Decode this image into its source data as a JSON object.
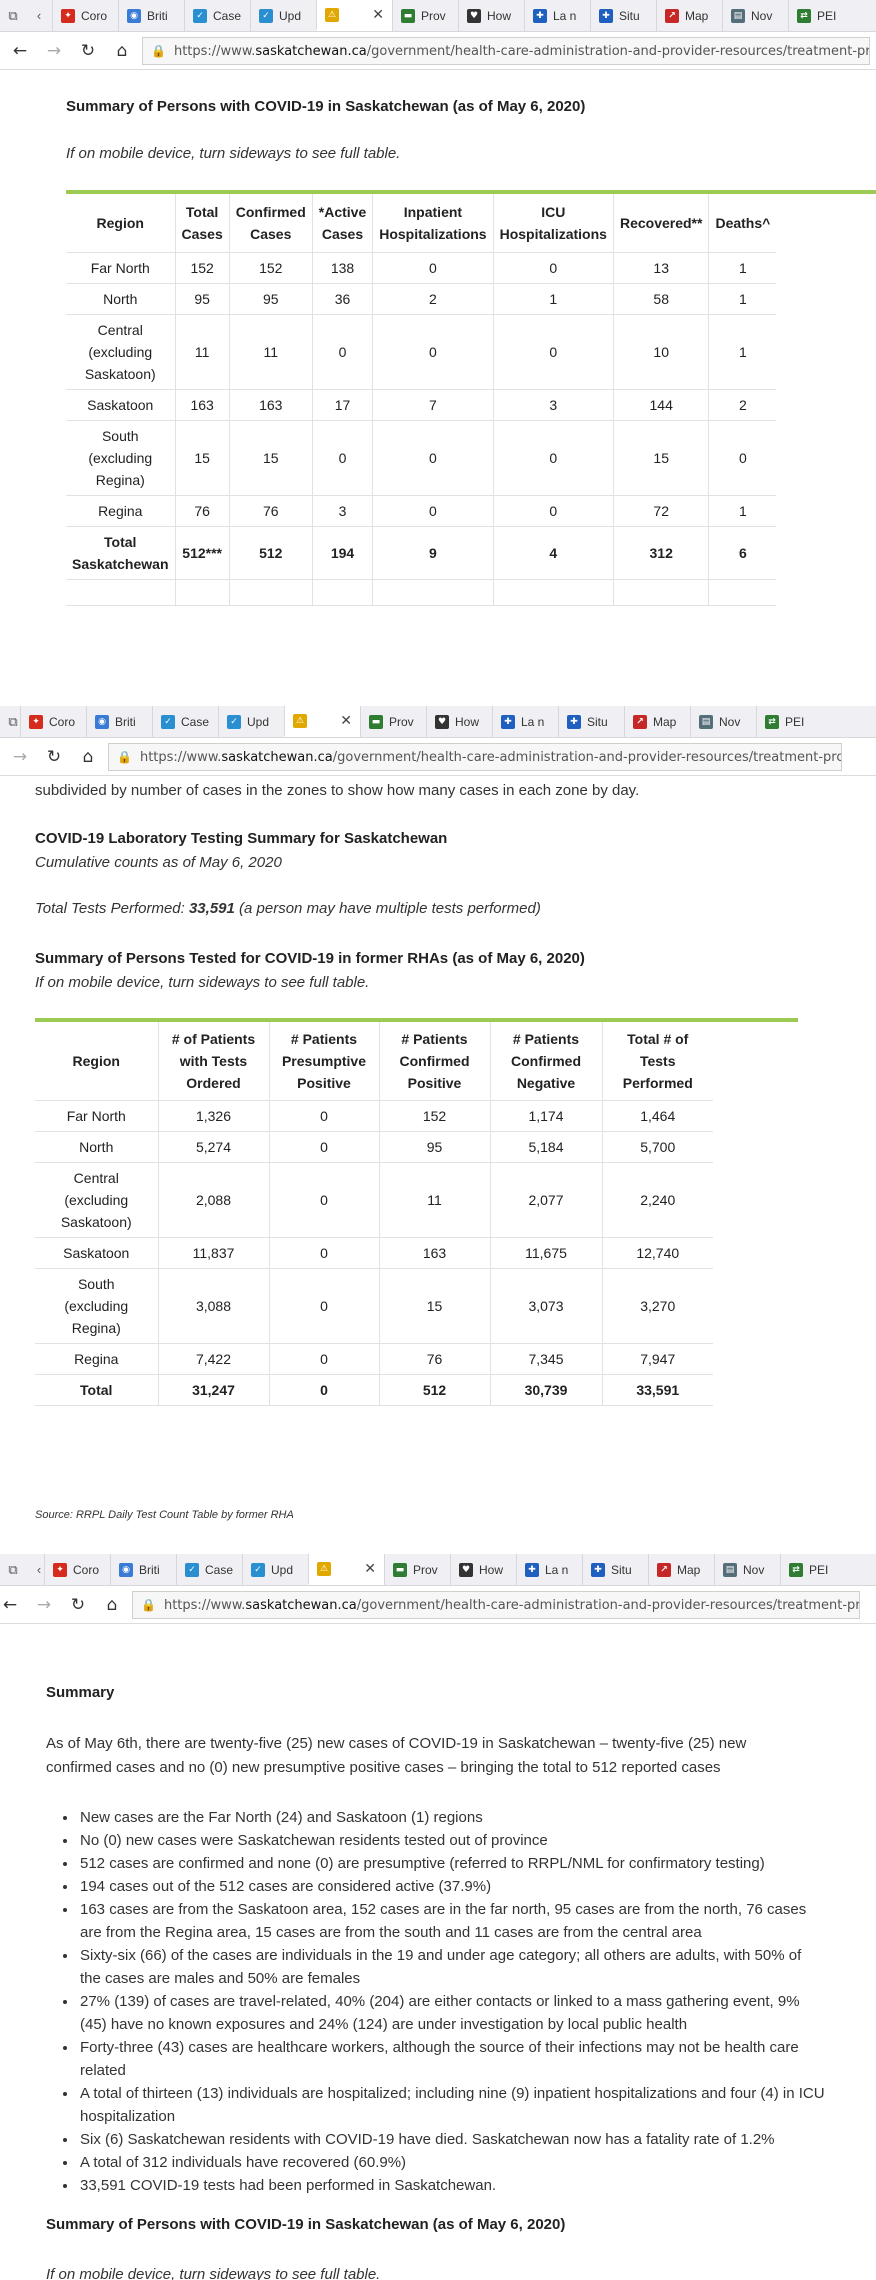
{
  "browser": {
    "tabs": [
      "Coro",
      "Briti",
      "Case",
      "Upd",
      "",
      "Prov",
      "How",
      "La n",
      "Situ",
      "Map",
      "Nov",
      "PEI"
    ],
    "tab_partial": "PEI (",
    "active_tab_close": "✕",
    "url_prefix": "https://www.",
    "url_host": "saskatchewan.ca",
    "url_path": "/government/health-care-administration-and-provider-resources/treatment-procedures-and-guidelines/emerging-public-health-issues/2019-novel-coronavirus/cases-and-risk-of-covid-19-in-saskatchewan"
  },
  "section1": {
    "title": "Summary of Persons with COVID-19 in Saskatchewan (as of May 6, 2020)",
    "note": "If on mobile device, turn sideways to see full table.",
    "table": {
      "headers": [
        [
          "Region"
        ],
        [
          "Total",
          "Cases"
        ],
        [
          "Confirmed",
          "Cases"
        ],
        [
          "*Active",
          "Cases"
        ],
        [
          "Inpatient",
          "Hospitalizations"
        ],
        [
          "ICU",
          "Hospitalizations"
        ],
        [
          "Recovered**"
        ],
        [
          "Deaths^"
        ]
      ],
      "rows": [
        [
          [
            "Far North"
          ],
          "152",
          "152",
          "138",
          "0",
          "0",
          "13",
          "1"
        ],
        [
          [
            "North"
          ],
          "95",
          "95",
          "36",
          "2",
          "1",
          "58",
          "1"
        ],
        [
          [
            "Central",
            "(excluding",
            "Saskatoon)"
          ],
          "11",
          "11",
          "0",
          "0",
          "0",
          "10",
          "1"
        ],
        [
          [
            "Saskatoon"
          ],
          "163",
          "163",
          "17",
          "7",
          "3",
          "144",
          "2"
        ],
        [
          [
            "South",
            "(excluding",
            "Regina)"
          ],
          "15",
          "15",
          "0",
          "0",
          "0",
          "15",
          "0"
        ],
        [
          [
            "Regina"
          ],
          "76",
          "76",
          "3",
          "0",
          "0",
          "72",
          "1"
        ]
      ],
      "total": [
        [
          "Total",
          "Saskatchewan"
        ],
        "512***",
        "512",
        "194",
        "9",
        "4",
        "312",
        "6"
      ]
    }
  },
  "section2": {
    "intro_tail": "subdivided by number of cases in the zones to show how many cases in each zone by day.",
    "lab_title": "COVID-19 Laboratory Testing Summary for Saskatchewan",
    "lab_sub": "Cumulative counts as of May 6, 2020",
    "tests_prefix": "Total Tests Performed: ",
    "tests_value": "33,591",
    "tests_suffix": " (a person may have multiple tests performed)",
    "title": "Summary of Persons Tested for COVID-19 in former RHAs (as of May 6, 2020)",
    "note": "If on mobile device, turn sideways to see full table.",
    "table": {
      "headers": [
        [
          "Region"
        ],
        [
          "# of Patients",
          "with Tests",
          "Ordered"
        ],
        [
          "# Patients",
          "Presumptive",
          "Positive"
        ],
        [
          "# Patients",
          "Confirmed",
          "Positive"
        ],
        [
          "# Patients",
          "Confirmed",
          "Negative"
        ],
        [
          "Total # of",
          "Tests",
          "Performed"
        ]
      ],
      "rows": [
        [
          [
            "Far North"
          ],
          "1,326",
          "0",
          "152",
          "1,174",
          "1,464"
        ],
        [
          [
            "North"
          ],
          "5,274",
          "0",
          "95",
          "5,184",
          "5,700"
        ],
        [
          [
            "Central",
            "(excluding",
            "Saskatoon)"
          ],
          "2,088",
          "0",
          "11",
          "2,077",
          "2,240"
        ],
        [
          [
            "Saskatoon"
          ],
          "11,837",
          "0",
          "163",
          "11,675",
          "12,740"
        ],
        [
          [
            "South",
            "(excluding",
            "Regina)"
          ],
          "3,088",
          "0",
          "15",
          "3,073",
          "3,270"
        ],
        [
          [
            "Regina"
          ],
          "7,422",
          "0",
          "76",
          "7,345",
          "7,947"
        ]
      ],
      "total": [
        [
          "Total"
        ],
        "31,247",
        "0",
        "512",
        "30,739",
        "33,591"
      ]
    },
    "source": "Source: RRPL Daily Test Count Table by former RHA"
  },
  "section3": {
    "title": "Summary",
    "lead": "As of May 6th, there are twenty-five (25) new cases of COVID-19 in Saskatchewan – twenty-five (25) new confirmed cases and no (0) new presumptive positive cases – bringing the total to 512 reported cases",
    "bullets": [
      "New cases are the Far North (24) and Saskatoon (1) regions",
      "No (0) new cases were Saskatchewan residents tested out of province",
      "512 cases are confirmed and none (0) are presumptive (referred to RRPL/NML for confirmatory testing)",
      "194 cases out of the 512 cases are considered active (37.9%)",
      "163 cases are from the Saskatoon area, 152 cases are in the far north, 95 cases are from the north, 76 cases are from the Regina area, 15 cases are from the south and 11 cases are from the central area",
      "Sixty-six (66) of the cases are individuals in the 19 and under age category; all others are adults, with 50% of the cases are males and 50% are females",
      "27% (139) of cases are travel-related, 40% (204) are either contacts or linked to a mass gathering event, 9% (45) have no known exposures and 24% (124) are under investigation by local public health",
      "Forty-three (43) cases are healthcare workers, although the source of their infections may not be health care related",
      "A total of thirteen (13) individuals are hospitalized; including nine (9) inpatient hospitalizations and four (4) in ICU hospitalization",
      "Six (6) Saskatchewan residents with COVID-19 have died. Saskatchewan now has a fatality rate of 1.2%",
      "A total of 312 individuals have recovered (60.9%)",
      "33,591 COVID-19 tests had been performed in Saskatchewan."
    ],
    "title2": "Summary of Persons with COVID-19 in Saskatchewan (as of May 6, 2020)",
    "note2": "If on mobile device, turn sideways to see full table."
  }
}
